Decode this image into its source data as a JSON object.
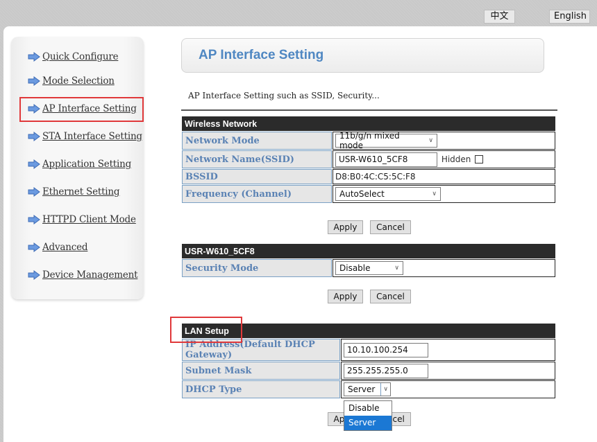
{
  "language": {
    "chinese_label": "中文",
    "english_label": "English"
  },
  "sidebar": {
    "items": [
      {
        "label": "Quick Configure"
      },
      {
        "label": "Mode Selection"
      },
      {
        "label": "AP Interface Setting",
        "selected": true
      },
      {
        "label": "STA Interface Setting"
      },
      {
        "label": "Application Setting"
      },
      {
        "label": "Ethernet Setting"
      },
      {
        "label": "HTTPD Client Mode"
      },
      {
        "label": "Advanced"
      },
      {
        "label": "Device Management"
      }
    ]
  },
  "header": {
    "title": "AP Interface Setting",
    "description": "AP Interface Setting such as SSID, Security..."
  },
  "wireless": {
    "section_title": "Wireless Network",
    "network_mode_label": "Network Mode",
    "network_mode_value": "11b/g/n mixed mode",
    "ssid_label": "Network Name(SSID)",
    "ssid_value": "USR-W610_5CF8",
    "hidden_label": "Hidden",
    "hidden_checked": false,
    "bssid_label": "BSSID",
    "bssid_value": "D8:B0:4C:C5:5C:F8",
    "frequency_label": "Frequency (Channel)",
    "frequency_value": "AutoSelect",
    "apply_label": "Apply",
    "cancel_label": "Cancel"
  },
  "security": {
    "section_title": "USR-W610_5CF8",
    "security_mode_label": "Security Mode",
    "security_mode_value": "Disable",
    "apply_label": "Apply",
    "cancel_label": "Cancel"
  },
  "lan": {
    "section_title": "LAN Setup",
    "ip_label": "IP Address(Default DHCP Gateway)",
    "ip_value": "10.10.100.254",
    "subnet_label": "Subnet Mask",
    "subnet_value": "255.255.255.0",
    "dhcp_label": "DHCP Type",
    "dhcp_value": "Server",
    "dhcp_options": [
      {
        "label": "Disable"
      },
      {
        "label": "Server",
        "highlighted": true
      }
    ],
    "apply_label": "Apply",
    "cancel_label": "Cancel"
  },
  "colors": {
    "accent_blue": "#4f87c2",
    "label_blue": "#5a82b4",
    "highlight_red": "#e0383a",
    "section_header": "#2b2b2b",
    "dropdown_active": "#1b78d4"
  }
}
